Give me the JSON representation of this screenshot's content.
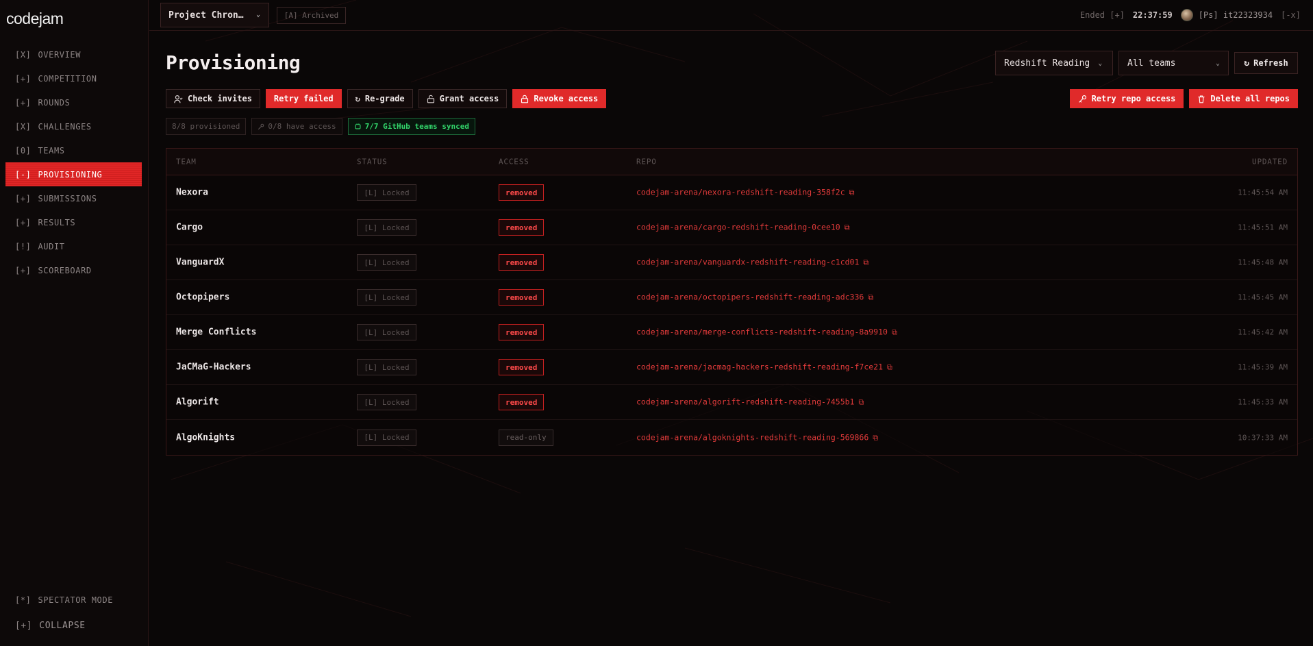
{
  "app": {
    "logo": "codejam"
  },
  "sidebar": {
    "items": [
      {
        "mark": "[X]",
        "label": "OVERVIEW",
        "active": false
      },
      {
        "mark": "[+]",
        "label": "COMPETITION",
        "active": false
      },
      {
        "mark": "[+]",
        "label": "ROUNDS",
        "active": false
      },
      {
        "mark": "[X]",
        "label": "CHALLENGES",
        "active": false
      },
      {
        "mark": "[0]",
        "label": "TEAMS",
        "active": false
      },
      {
        "mark": "[-]",
        "label": "PROVISIONING",
        "active": true
      },
      {
        "mark": "[+]",
        "label": "SUBMISSIONS",
        "active": false
      },
      {
        "mark": "[+]",
        "label": "RESULTS",
        "active": false
      },
      {
        "mark": "[!]",
        "label": "AUDIT",
        "active": false
      },
      {
        "mark": "[+]",
        "label": "SCOREBOARD",
        "active": false
      }
    ],
    "spectator": {
      "mark": "[*]",
      "label": "SPECTATOR MODE"
    },
    "collapse": {
      "mark": "[+]",
      "label": "COLLAPSE"
    }
  },
  "topbar": {
    "project": "Project Chron…",
    "archived": "[A] Archived",
    "ended": "Ended [+]",
    "clock": "22:37:59",
    "user": "[Ps] it22323934",
    "logout": "[-x]"
  },
  "page": {
    "title": "Provisioning",
    "round_select": "Redshift Reading",
    "team_select": "All teams",
    "refresh": "Refresh"
  },
  "actions": {
    "check_invites": "Check invites",
    "retry_failed": "Retry failed",
    "regrade": "Re-grade",
    "grant_access": "Grant access",
    "revoke_access": "Revoke access",
    "retry_repo_access": "Retry repo access",
    "delete_all_repos": "Delete all repos"
  },
  "stats": {
    "provisioned": "8/8 provisioned",
    "have_access": "0/8 have access",
    "synced": "7/7 GitHub teams synced"
  },
  "table": {
    "headers": {
      "team": "TEAM",
      "status": "STATUS",
      "access": "ACCESS",
      "repo": "REPO",
      "updated": "UPDATED"
    },
    "rows": [
      {
        "team": "Nexora",
        "status": "[L] Locked",
        "access": "removed",
        "repo": "codejam-arena/nexora-redshift-reading-358f2c",
        "updated": "11:45:54 AM"
      },
      {
        "team": "Cargo",
        "status": "[L] Locked",
        "access": "removed",
        "repo": "codejam-arena/cargo-redshift-reading-0cee10",
        "updated": "11:45:51 AM"
      },
      {
        "team": "VanguardX",
        "status": "[L] Locked",
        "access": "removed",
        "repo": "codejam-arena/vanguardx-redshift-reading-c1cd01",
        "updated": "11:45:48 AM"
      },
      {
        "team": "Octopipers",
        "status": "[L] Locked",
        "access": "removed",
        "repo": "codejam-arena/octopipers-redshift-reading-adc336",
        "updated": "11:45:45 AM"
      },
      {
        "team": "Merge Conflicts",
        "status": "[L] Locked",
        "access": "removed",
        "repo": "codejam-arena/merge-conflicts-redshift-reading-8a9910",
        "updated": "11:45:42 AM"
      },
      {
        "team": "JaCMaG-Hackers",
        "status": "[L] Locked",
        "access": "removed",
        "repo": "codejam-arena/jacmag-hackers-redshift-reading-f7ce21",
        "updated": "11:45:39 AM"
      },
      {
        "team": "Algorift",
        "status": "[L] Locked",
        "access": "removed",
        "repo": "codejam-arena/algorift-redshift-reading-7455b1",
        "updated": "11:45:33 AM"
      },
      {
        "team": "AlgoKnights",
        "status": "[L] Locked",
        "access": "read-only",
        "repo": "codejam-arena/algoknights-redshift-reading-569866",
        "updated": "10:37:33 AM"
      }
    ]
  },
  "colors": {
    "accent": "#e02a2a",
    "success": "#32d46a",
    "background": "#0a0707"
  }
}
